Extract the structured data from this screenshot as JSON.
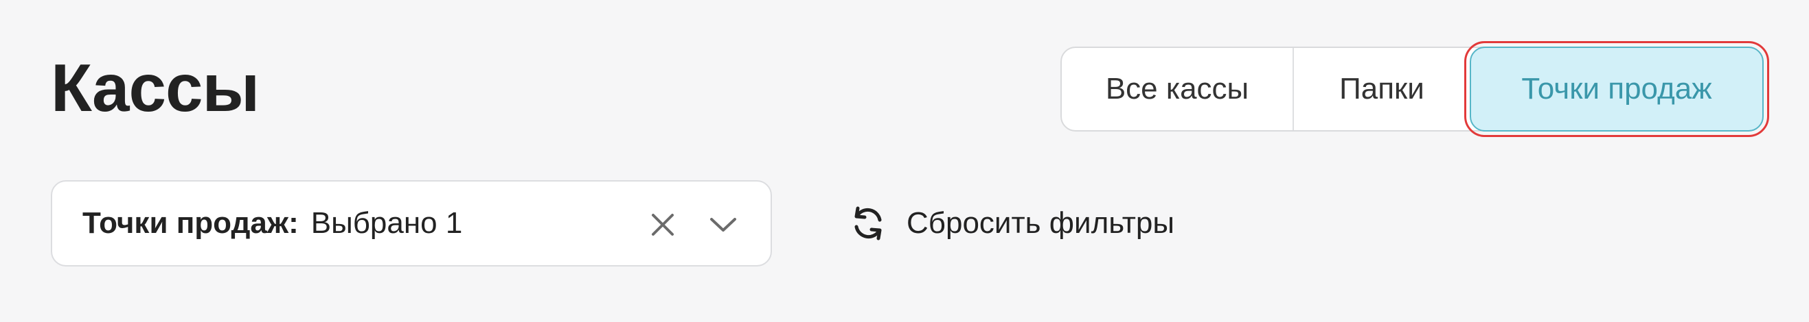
{
  "header": {
    "title": "Кассы"
  },
  "view_tabs": {
    "selected": "Точки продаж",
    "items": [
      {
        "label": "Все кассы"
      },
      {
        "label": "Папки"
      },
      {
        "label": "Точки продаж"
      }
    ]
  },
  "filters": {
    "points_filter": {
      "label": "Точки продаж:",
      "value": "Выбрано 1",
      "clear_icon": "close-icon",
      "dropdown_icon": "chevron-down-icon"
    },
    "reset": {
      "label": "Сбросить фильтры",
      "icon": "refresh-icon"
    }
  },
  "colors": {
    "background": "#f6f6f7",
    "selected_tab_bg": "#d2f0f8",
    "selected_tab_text": "#3a97aa",
    "selected_tab_border": "#56b6c8",
    "highlight_outline": "#e23a3a"
  }
}
